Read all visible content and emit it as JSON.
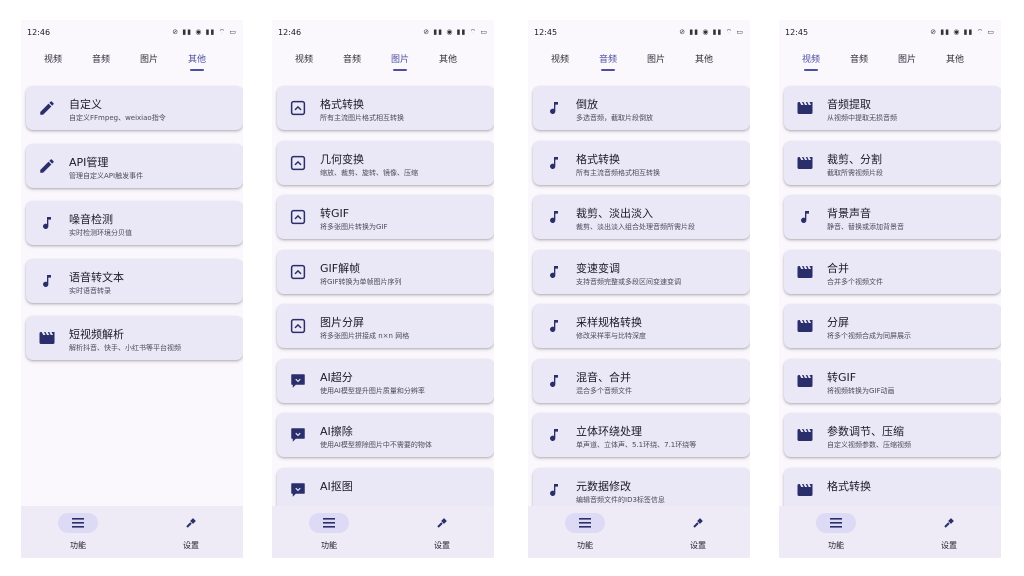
{
  "screens": [
    {
      "time": "12:46",
      "status_icons": "⊘ ▮▮ ◉ ▮▮ ⌔ ▭",
      "tabs": [
        "视频",
        "音频",
        "图片",
        "其他"
      ],
      "active_tab": 3,
      "items": [
        {
          "icon": "pencil-icon",
          "title": "自定义",
          "desc": "自定义FFmpeg、weixiao指令"
        },
        {
          "icon": "pencil-icon",
          "title": "API管理",
          "desc": "管理自定义API触发事件"
        },
        {
          "icon": "music-note-icon",
          "title": "噪音检测",
          "desc": "实时检测环境分贝值"
        },
        {
          "icon": "music-note-icon",
          "title": "语音转文本",
          "desc": "实时语音转录"
        },
        {
          "icon": "clapperboard-icon",
          "title": "短视频解析",
          "desc": "解析抖音、快手、小红书等平台视频"
        }
      ],
      "nav": [
        {
          "label": "功能"
        },
        {
          "label": "设置"
        }
      ],
      "active_nav": 0
    },
    {
      "time": "12:46",
      "status_icons": "⊘ ▮▮ ◉ ▮▮ ⌔ ▭",
      "tabs": [
        "视频",
        "音频",
        "图片",
        "其他"
      ],
      "active_tab": 2,
      "items": [
        {
          "icon": "image-icon",
          "title": "格式转换",
          "desc": "所有主流图片格式相互转换"
        },
        {
          "icon": "image-icon",
          "title": "几何变换",
          "desc": "缩放、裁剪、旋转、镜像、压缩"
        },
        {
          "icon": "image-icon",
          "title": "转GIF",
          "desc": "将多张图片转换为GIF"
        },
        {
          "icon": "image-icon",
          "title": "GIF解帧",
          "desc": "将GIF转换为单帧图片序列"
        },
        {
          "icon": "image-icon",
          "title": "图片分屏",
          "desc": "将多张图片拼接成 n×n 网格"
        },
        {
          "icon": "ai-chat-icon",
          "title": "AI超分",
          "desc": "使用AI模型提升图片质量和分辨率"
        },
        {
          "icon": "ai-chat-icon",
          "title": "AI擦除",
          "desc": "使用AI模型擦除图片中不需要的物体"
        },
        {
          "icon": "ai-chat-icon",
          "title": "AI抠图",
          "desc": ""
        }
      ],
      "nav": [
        {
          "label": "功能"
        },
        {
          "label": "设置"
        }
      ],
      "active_nav": 0
    },
    {
      "time": "12:45",
      "status_icons": "⊘ ▮▮ ◉ ▮▮ ⌔ ▭",
      "tabs": [
        "视频",
        "音频",
        "图片",
        "其他"
      ],
      "active_tab": 1,
      "items": [
        {
          "icon": "music-note-icon",
          "title": "倒放",
          "desc": "多选音频，截取片段倒放"
        },
        {
          "icon": "music-note-icon",
          "title": "格式转换",
          "desc": "所有主流音频格式相互转换"
        },
        {
          "icon": "music-note-icon",
          "title": "裁剪、淡出淡入",
          "desc": "裁剪、淡出淡入组合处理音频所需片段"
        },
        {
          "icon": "music-note-icon",
          "title": "变速变调",
          "desc": "支持音频完整或多段区间变速变调"
        },
        {
          "icon": "music-note-icon",
          "title": "采样规格转换",
          "desc": "修改采样率与比特深度"
        },
        {
          "icon": "music-note-icon",
          "title": "混音、合并",
          "desc": "混合多个音频文件"
        },
        {
          "icon": "music-note-icon",
          "title": "立体环绕处理",
          "desc": "单声道、立体声、5.1环绕、7.1环绕等"
        },
        {
          "icon": "music-note-icon",
          "title": "元数据修改",
          "desc": "编辑音频文件的ID3标签信息"
        }
      ],
      "nav": [
        {
          "label": "功能"
        },
        {
          "label": "设置"
        }
      ],
      "active_nav": 0
    },
    {
      "time": "12:45",
      "status_icons": "⊘ ▮▮ ◉ ▮▮ ⌔ ▭",
      "tabs": [
        "视频",
        "音频",
        "图片",
        "其他"
      ],
      "active_tab": 0,
      "items": [
        {
          "icon": "clapperboard-icon",
          "title": "音频提取",
          "desc": "从视频中提取无损音频"
        },
        {
          "icon": "clapperboard-icon",
          "title": "裁剪、分割",
          "desc": "截取所需视频片段"
        },
        {
          "icon": "music-note-icon",
          "title": "背景声音",
          "desc": "静音、替换或添加背景音"
        },
        {
          "icon": "clapperboard-icon",
          "title": "合并",
          "desc": "合并多个视频文件"
        },
        {
          "icon": "clapperboard-icon",
          "title": "分屏",
          "desc": "将多个视频合成为同屏展示"
        },
        {
          "icon": "clapperboard-icon",
          "title": "转GIF",
          "desc": "将视频转换为GIF动画"
        },
        {
          "icon": "clapperboard-icon",
          "title": "参数调节、压缩",
          "desc": "自定义视频参数、压缩视频"
        },
        {
          "icon": "clapperboard-icon",
          "title": "格式转换",
          "desc": ""
        }
      ],
      "nav": [
        {
          "label": "功能"
        },
        {
          "label": "设置"
        }
      ],
      "active_nav": 0
    }
  ],
  "colors": {
    "accent": "#4a4fa0",
    "card_bg": "#eae7f6",
    "nav_bg": "#eeebf7",
    "icon": "#2a2e6a"
  }
}
